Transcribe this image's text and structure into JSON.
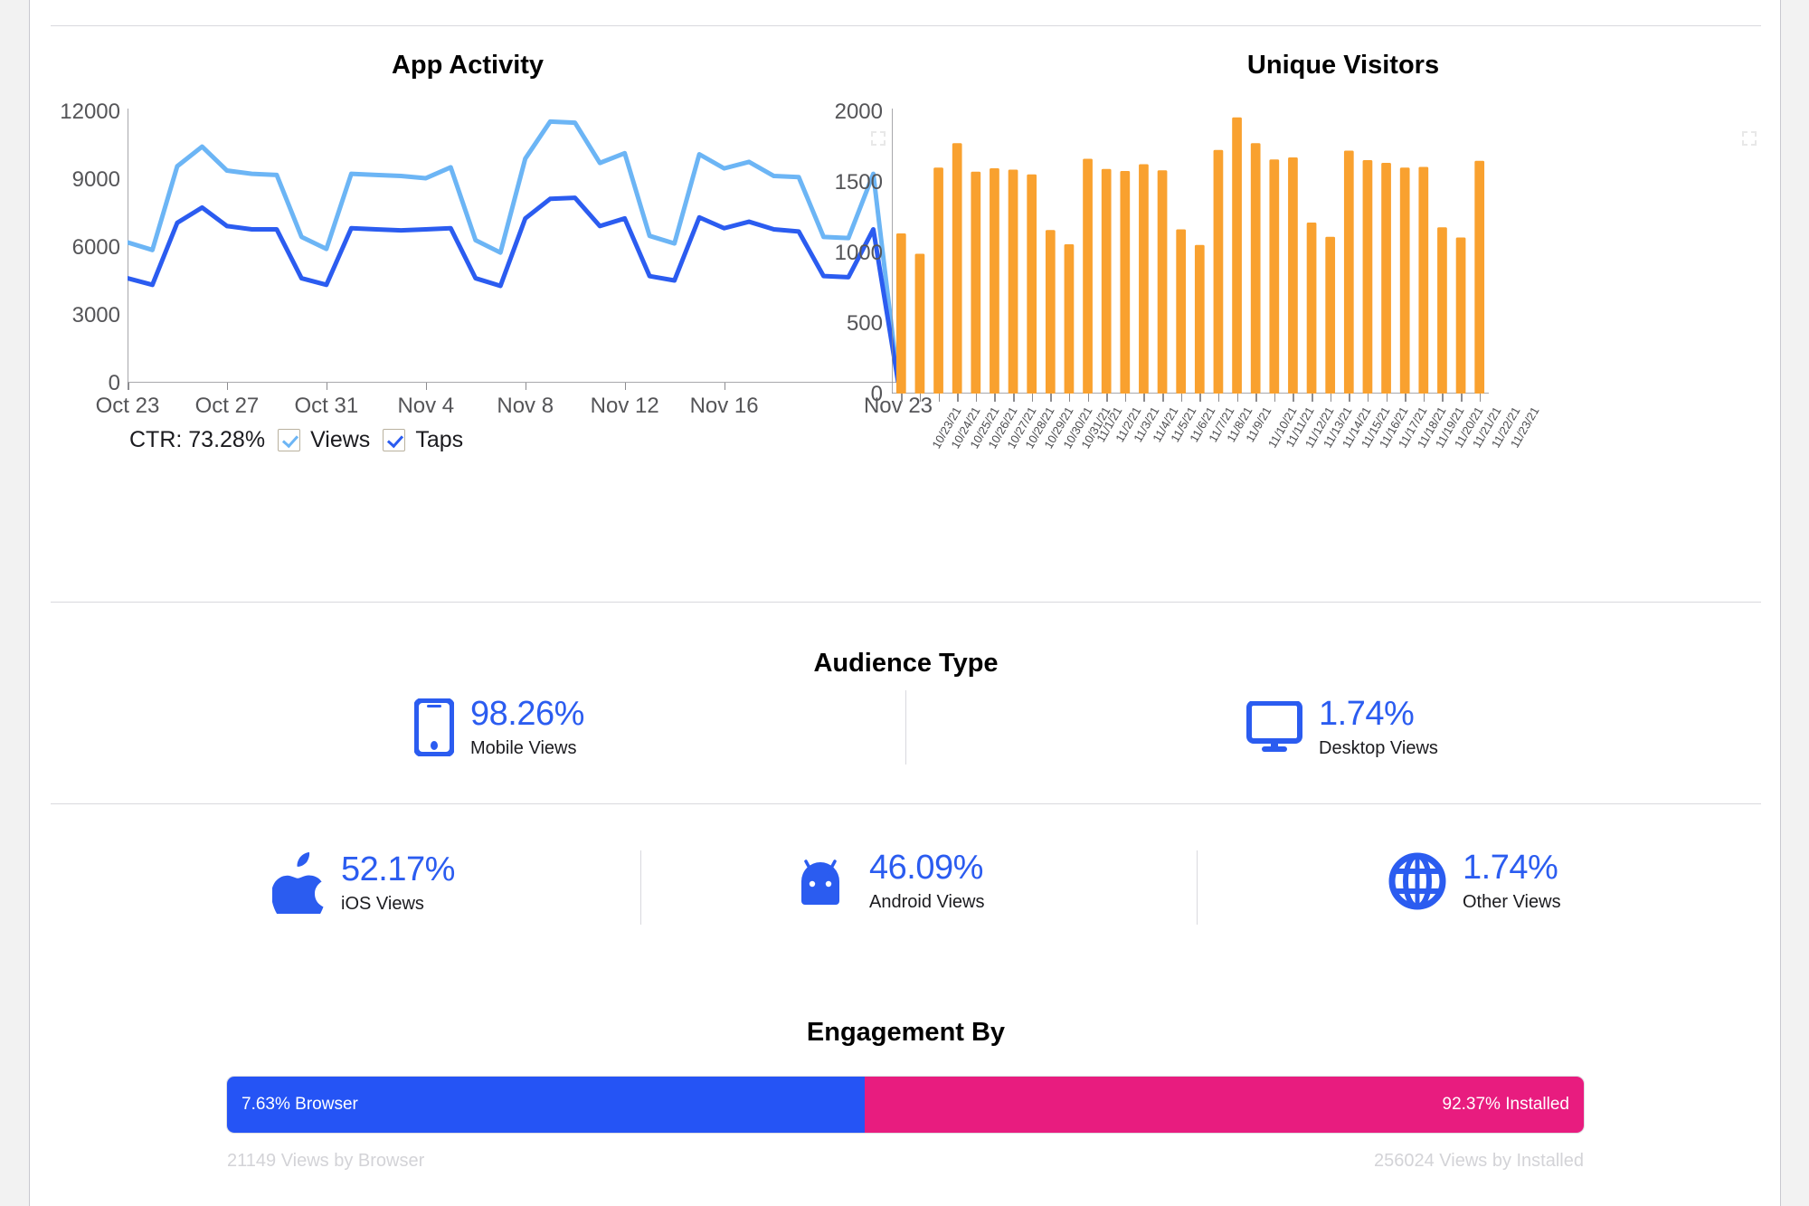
{
  "layout": {
    "card_bg": "#ffffff",
    "page_bg": "#f2f2f2",
    "accent_blue": "#2b5cf0",
    "accent_light_blue": "#6cb5f5",
    "accent_orange": "#f9a12f",
    "accent_pink": "#e81c7f",
    "muted_text": "#d3d3d7"
  },
  "app_activity": {
    "title": "App Activity",
    "expand_icon": "fullscreen-expand-icon",
    "ctr_label": "CTR: 73.28%",
    "legend": [
      {
        "label": "Views",
        "checked": true,
        "color": "#6cb5f5"
      },
      {
        "label": "Taps",
        "checked": true,
        "color": "#2b5cf0"
      }
    ]
  },
  "unique_visitors": {
    "title": "Unique Visitors",
    "expand_icon": "fullscreen-expand-icon"
  },
  "audience_type": {
    "title": "Audience Type",
    "items": [
      {
        "icon": "mobile-phone-icon",
        "percent": "98.26%",
        "label": "Mobile Views"
      },
      {
        "icon": "desktop-monitor-icon",
        "percent": "1.74%",
        "label": "Desktop Views"
      }
    ]
  },
  "platform_breakdown": {
    "items": [
      {
        "icon": "apple-logo-icon",
        "percent": "52.17%",
        "label": "iOS Views"
      },
      {
        "icon": "android-robot-icon",
        "percent": "46.09%",
        "label": "Android Views"
      },
      {
        "icon": "globe-icon",
        "percent": "1.74%",
        "label": "Other Views"
      }
    ]
  },
  "engagement_by": {
    "title": "Engagement By",
    "segments": [
      {
        "label": "7.63% Browser",
        "color": "#2554f5",
        "width_pct": 47.0,
        "footer": "21149 Views by Browser"
      },
      {
        "label": "92.37% Installed",
        "color": "#e81c7f",
        "width_pct": 53.0,
        "footer": "256024 Views by Installed"
      }
    ]
  },
  "chart_data": [
    {
      "type": "line",
      "title": "App Activity",
      "xlabel": "",
      "ylabel": "",
      "ylim": [
        0,
        12600
      ],
      "yticks": [
        0,
        3000,
        6000,
        9000,
        12000
      ],
      "grid": false,
      "legend": [
        "Views",
        "Taps"
      ],
      "legend_position": "bottom-left",
      "x_tick_labels": [
        "Oct 23",
        "Oct 27",
        "Oct 31",
        "Nov 4",
        "Nov 8",
        "Nov 12",
        "Nov 16",
        "Nov 23"
      ],
      "x_tick_indices": [
        0,
        4,
        8,
        12,
        16,
        20,
        24,
        31
      ],
      "x": [
        "10/23/21",
        "10/24/21",
        "10/25/21",
        "10/26/21",
        "10/27/21",
        "10/28/21",
        "10/29/21",
        "10/30/21",
        "10/31/21",
        "11/1/21",
        "11/2/21",
        "11/3/21",
        "11/4/21",
        "11/5/21",
        "11/6/21",
        "11/7/21",
        "11/8/21",
        "11/9/21",
        "11/10/21",
        "11/11/21",
        "11/12/21",
        "11/13/21",
        "11/14/21",
        "11/15/21",
        "11/16/21",
        "11/17/21",
        "11/18/21",
        "11/19/21",
        "11/20/21",
        "11/21/21",
        "11/22/21",
        "11/23/21"
      ],
      "series": [
        {
          "name": "Views",
          "color": "#6cb5f5",
          "values": [
            6450,
            6100,
            9950,
            10850,
            9750,
            9600,
            9550,
            6700,
            6150,
            9600,
            9550,
            9500,
            9400,
            9900,
            6550,
            5980,
            10300,
            12000,
            11950,
            10100,
            10550,
            6750,
            6400,
            10500,
            9850,
            10150,
            9500,
            9450,
            6700,
            6650,
            9600,
            30
          ]
        },
        {
          "name": "Taps",
          "color": "#2b5cf0",
          "values": [
            4800,
            4500,
            7350,
            8050,
            7200,
            7050,
            7050,
            4800,
            4500,
            7100,
            7050,
            7000,
            7050,
            7100,
            4800,
            4450,
            7550,
            8450,
            8500,
            7200,
            7550,
            4900,
            4700,
            7600,
            7100,
            7400,
            7050,
            6950,
            4900,
            4850,
            7050,
            20
          ]
        }
      ]
    },
    {
      "type": "bar",
      "title": "Unique Visitors",
      "xlabel": "",
      "ylabel": "",
      "ylim": [
        0,
        2100
      ],
      "yticks": [
        0,
        500,
        1000,
        1500,
        2000
      ],
      "grid": false,
      "color": "#f9a12f",
      "categories": [
        "10/23/21",
        "10/24/21",
        "10/25/21",
        "10/26/21",
        "10/27/21",
        "10/28/21",
        "10/29/21",
        "10/30/21",
        "10/31/21",
        "11/1/21",
        "11/2/21",
        "11/3/21",
        "11/4/21",
        "11/5/21",
        "11/6/21",
        "11/7/21",
        "11/8/21",
        "11/9/21",
        "11/10/21",
        "11/11/21",
        "11/12/21",
        "11/13/21",
        "11/14/21",
        "11/15/21",
        "11/16/21",
        "11/17/21",
        "11/18/21",
        "11/19/21",
        "11/20/21",
        "11/21/21",
        "11/22/21",
        "11/23/21"
      ],
      "values": [
        1180,
        1030,
        1665,
        1845,
        1635,
        1660,
        1650,
        1615,
        1205,
        1100,
        1730,
        1655,
        1640,
        1690,
        1645,
        1210,
        1095,
        1795,
        2035,
        1845,
        1725,
        1740,
        1260,
        1155,
        1790,
        1720,
        1700,
        1665,
        1670,
        1225,
        1150,
        1715
      ]
    }
  ]
}
